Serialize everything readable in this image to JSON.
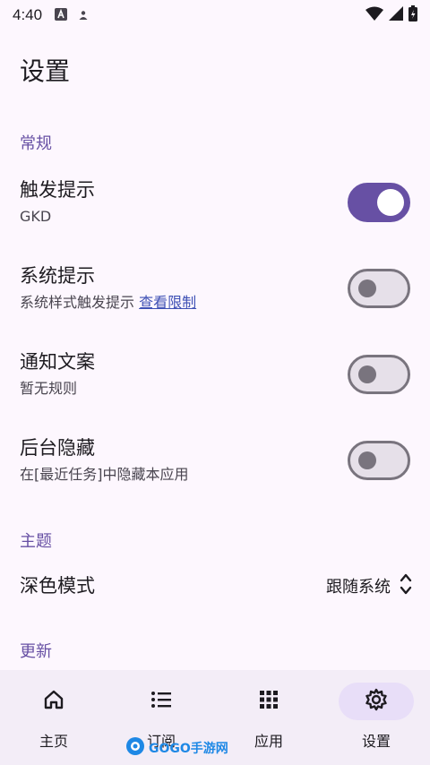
{
  "status_bar": {
    "time": "4:40"
  },
  "page": {
    "title": "设置"
  },
  "sections": {
    "general": "常规",
    "theme": "主题",
    "update": "更新"
  },
  "settings": {
    "trigger_tip": {
      "title": "触发提示",
      "subtitle": "GKD",
      "enabled": true
    },
    "system_tip": {
      "title": "系统提示",
      "subtitle": "系统样式触发提示",
      "link": "查看限制",
      "enabled": false
    },
    "notify_copy": {
      "title": "通知文案",
      "subtitle": "暂无规则",
      "enabled": false
    },
    "background_hide": {
      "title": "后台隐藏",
      "subtitle": "在[最近任务]中隐藏本应用",
      "enabled": false
    }
  },
  "dark_mode": {
    "label": "深色模式",
    "value": "跟随系统"
  },
  "nav": {
    "items": [
      {
        "label": "主页",
        "icon": "home-icon",
        "active": false
      },
      {
        "label": "订阅",
        "icon": "list-icon",
        "active": false
      },
      {
        "label": "应用",
        "icon": "apps-grid-icon",
        "active": false
      },
      {
        "label": "设置",
        "icon": "settings-gear-icon",
        "active": true
      }
    ]
  },
  "watermark": {
    "text": "GOGO手游网"
  },
  "colors": {
    "accent": "#6750a4",
    "background": "#fdf7fe",
    "nav_background": "#f3edf7",
    "nav_active": "#e8def8"
  }
}
